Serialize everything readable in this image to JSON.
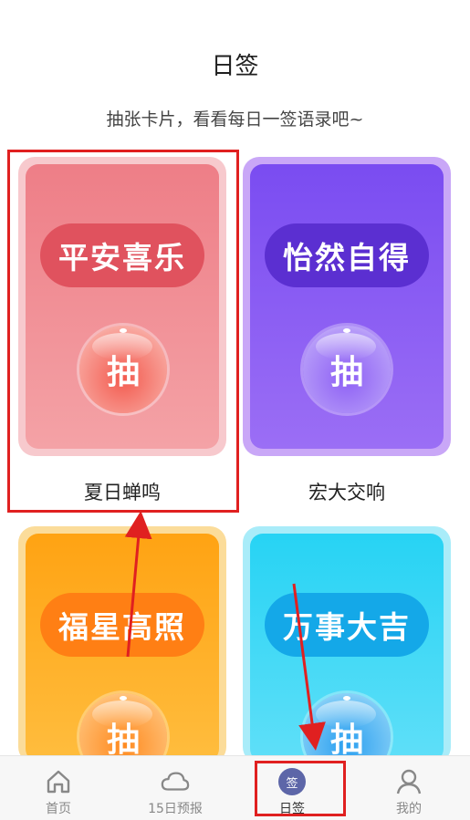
{
  "page": {
    "title": "日签",
    "subtitle": "抽张卡片，看看每日一签语录吧~"
  },
  "cards": [
    {
      "phrase": "平安喜乐",
      "button": "抽",
      "name": "夏日蝉鸣",
      "theme": "pink"
    },
    {
      "phrase": "怡然自得",
      "button": "抽",
      "name": "宏大交响",
      "theme": "purple"
    },
    {
      "phrase": "福星高照",
      "button": "抽",
      "theme": "orange"
    },
    {
      "phrase": "万事大吉",
      "button": "抽",
      "theme": "cyan"
    }
  ],
  "tabbar": {
    "items": [
      {
        "label": "首页",
        "icon": "home-icon"
      },
      {
        "label": "15日预报",
        "icon": "cloud-icon"
      },
      {
        "label": "日签",
        "icon": "sign-badge-icon",
        "badge": "签",
        "active": true
      },
      {
        "label": "我的",
        "icon": "profile-icon"
      }
    ]
  },
  "colors": {
    "annotation_red": "#e02020",
    "active_badge": "#5d66a8"
  }
}
